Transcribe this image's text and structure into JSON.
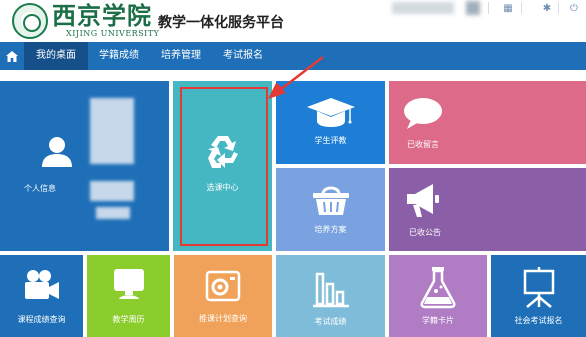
{
  "header": {
    "university_cn": "西京学院",
    "university_en": "XIJING UNIVERSITY",
    "portal_title": "教学一体化服务平台"
  },
  "nav": {
    "items": [
      {
        "label": "我的桌面"
      },
      {
        "label": "学籍成绩"
      },
      {
        "label": "培养管理"
      },
      {
        "label": "考试报名"
      }
    ]
  },
  "tiles": {
    "profile": "个人信息",
    "course_selection": "选课中心",
    "student_eval": "学生评教",
    "received_messages": "已收留言",
    "training_plan": "培养方案",
    "received_announcements": "已收公告",
    "course_grade_query": "课程成绩查询",
    "teaching_calendar": "教学周历",
    "recommended_plan_query": "推课计划查询",
    "exam_results": "考试成绩",
    "grade_card": "学籍卡片",
    "social_exam_registration": "社会考试报名"
  },
  "colors": {
    "brand_green": "#1c6e47",
    "nav_blue": "#1e6fb8",
    "nav_active": "#15508a",
    "annotation_red": "#e53935"
  }
}
